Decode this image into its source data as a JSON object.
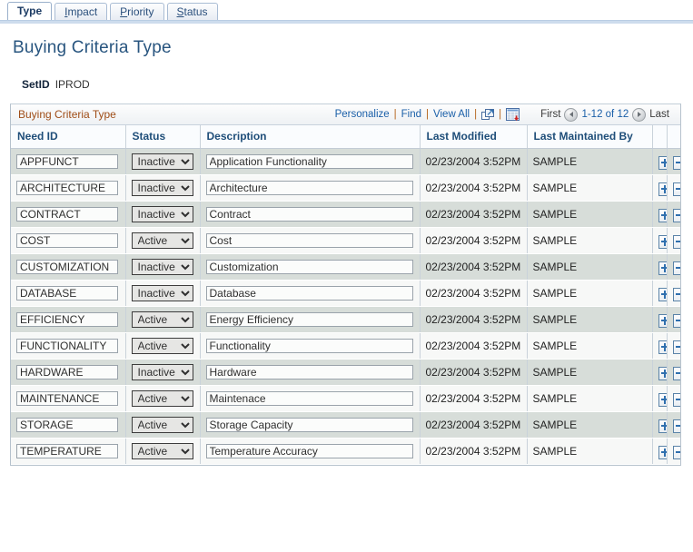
{
  "tabs": [
    {
      "label": "Type",
      "accel": "",
      "active": true
    },
    {
      "label": "Impact",
      "accel": "I",
      "active": false
    },
    {
      "label": "Priority",
      "accel": "P",
      "active": false
    },
    {
      "label": "Status",
      "accel": "S",
      "active": false
    }
  ],
  "page_title": "Buying Criteria Type",
  "setid": {
    "label": "SetID",
    "value": "IPROD"
  },
  "grid": {
    "caption": "Buying Criteria Type",
    "links": {
      "personalize": "Personalize",
      "find": "Find",
      "view_all": "View All",
      "separator": "|",
      "expand_icon": "expand-grid-icon",
      "excel_icon": "download-to-excel-icon"
    },
    "pager": {
      "first": "First",
      "count": "1-12 of 12",
      "last": "Last",
      "prev_icon": "previous-page-icon",
      "next_icon": "next-page-icon"
    },
    "columns": [
      "Need ID",
      "Status",
      "Description",
      "Last Modified",
      "Last Maintained By"
    ],
    "status_options": [
      "Active",
      "Inactive"
    ],
    "rows": [
      {
        "need_id": "APPFUNCT",
        "status": "Inactive",
        "description": "Application Functionality",
        "last_modified": "02/23/2004  3:52PM",
        "maintained_by": "SAMPLE"
      },
      {
        "need_id": "ARCHITECTURE",
        "status": "Inactive",
        "description": "Architecture",
        "last_modified": "02/23/2004  3:52PM",
        "maintained_by": "SAMPLE"
      },
      {
        "need_id": "CONTRACT",
        "status": "Inactive",
        "description": "Contract",
        "last_modified": "02/23/2004  3:52PM",
        "maintained_by": "SAMPLE"
      },
      {
        "need_id": "COST",
        "status": "Active",
        "description": "Cost",
        "last_modified": "02/23/2004  3:52PM",
        "maintained_by": "SAMPLE"
      },
      {
        "need_id": "CUSTOMIZATION",
        "status": "Inactive",
        "description": "Customization",
        "last_modified": "02/23/2004  3:52PM",
        "maintained_by": "SAMPLE"
      },
      {
        "need_id": "DATABASE",
        "status": "Inactive",
        "description": "Database",
        "last_modified": "02/23/2004  3:52PM",
        "maintained_by": "SAMPLE"
      },
      {
        "need_id": "EFFICIENCY",
        "status": "Active",
        "description": "Energy Efficiency",
        "last_modified": "02/23/2004  3:52PM",
        "maintained_by": "SAMPLE"
      },
      {
        "need_id": "FUNCTIONALITY",
        "status": "Active",
        "description": "Functionality",
        "last_modified": "02/23/2004  3:52PM",
        "maintained_by": "SAMPLE"
      },
      {
        "need_id": "HARDWARE",
        "status": "Inactive",
        "description": "Hardware",
        "last_modified": "02/23/2004  3:52PM",
        "maintained_by": "SAMPLE"
      },
      {
        "need_id": "MAINTENANCE",
        "status": "Active",
        "description": "Maintenace",
        "last_modified": "02/23/2004  3:52PM",
        "maintained_by": "SAMPLE"
      },
      {
        "need_id": "STORAGE",
        "status": "Active",
        "description": "Storage Capacity",
        "last_modified": "02/23/2004  3:52PM",
        "maintained_by": "SAMPLE"
      },
      {
        "need_id": "TEMPERATURE",
        "status": "Active",
        "description": "Temperature Accuracy",
        "last_modified": "02/23/2004  3:52PM",
        "maintained_by": "SAMPLE"
      }
    ],
    "row_actions": {
      "add_label": "+",
      "delete_label": "−"
    }
  },
  "colors": {
    "accent_link": "#1a5fa8",
    "caption": "#9f4d17",
    "header_text": "#1f4e79",
    "title": "#28557f",
    "row_odd": "#d7ddd9",
    "row_even": "#f7f8f7",
    "separator": "#b5651d"
  }
}
